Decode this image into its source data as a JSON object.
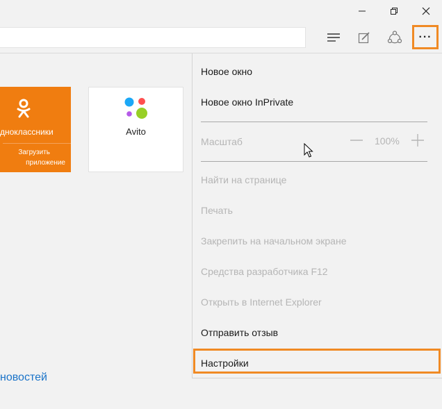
{
  "colors": {
    "accent": "#f08a24",
    "ok_orange": "#f07d10",
    "link_blue": "#1a73c8"
  },
  "toolbar": {
    "icons": [
      "hub-icon",
      "web-note-icon",
      "share-icon",
      "more-icon"
    ],
    "more_label": "···"
  },
  "tiles": [
    {
      "name": "дноклассники",
      "subtitle": [
        "Загрузить",
        "приложение"
      ],
      "icon": "odnoklassniki-logo"
    },
    {
      "name": "Avito",
      "icon": "avito-logo"
    }
  ],
  "news_link": "новостей",
  "menu": {
    "new_window": "Новое окно",
    "new_inprivate": "Новое окно InPrivate",
    "zoom_label": "Масштаб",
    "zoom_value": "100%",
    "find": "Найти на странице",
    "print": "Печать",
    "pin": "Закрепить на начальном экране",
    "devtools": "Средства разработчика F12",
    "open_ie": "Открыть в Internet Explorer",
    "feedback": "Отправить отзыв",
    "settings": "Настройки"
  }
}
